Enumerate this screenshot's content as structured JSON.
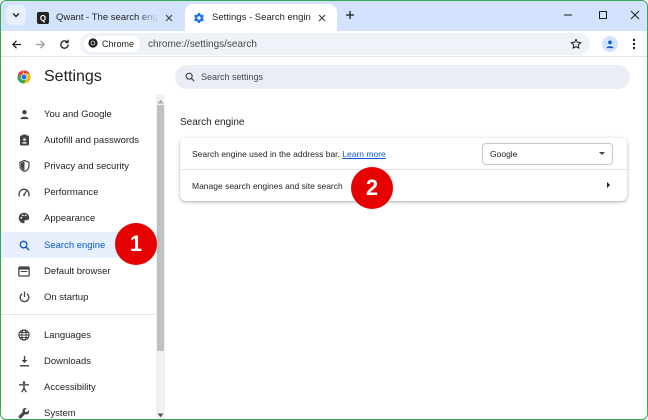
{
  "tabs": [
    {
      "title": "Qwant - The search engine that",
      "favicon": "qwant-icon",
      "active": false
    },
    {
      "title": "Settings - Search engine",
      "favicon": "gear-icon",
      "active": true
    }
  ],
  "toolbar": {
    "chip_label": "Chrome",
    "url": "chrome://settings/search"
  },
  "settings": {
    "title": "Settings",
    "search_placeholder": "Search settings"
  },
  "sidebar": {
    "items": [
      {
        "label": "You and Google",
        "icon": "person-icon"
      },
      {
        "label": "Autofill and passwords",
        "icon": "clipboard-icon"
      },
      {
        "label": "Privacy and security",
        "icon": "shield-icon"
      },
      {
        "label": "Performance",
        "icon": "speedometer-icon"
      },
      {
        "label": "Appearance",
        "icon": "palette-icon"
      },
      {
        "label": "Search engine",
        "icon": "search-icon",
        "selected": true
      },
      {
        "label": "Default browser",
        "icon": "browser-icon"
      },
      {
        "label": "On startup",
        "icon": "power-icon"
      },
      {
        "label": "Languages",
        "icon": "globe-icon"
      },
      {
        "label": "Downloads",
        "icon": "download-icon"
      },
      {
        "label": "Accessibility",
        "icon": "accessibility-icon"
      },
      {
        "label": "System",
        "icon": "wrench-icon"
      }
    ]
  },
  "main": {
    "section_title": "Search engine",
    "address_bar_label": "Search engine used in the address bar.",
    "learn_more": "Learn more",
    "selected_engine": "Google",
    "manage_label": "Manage search engines and site search"
  },
  "annotations": {
    "badge1": "1",
    "badge2": "2"
  },
  "colors": {
    "accent": "#0b57d0",
    "tabstrip": "#d3e3fd",
    "selected_nav_bg": "#e8f0fe",
    "badge": "#e60000"
  }
}
